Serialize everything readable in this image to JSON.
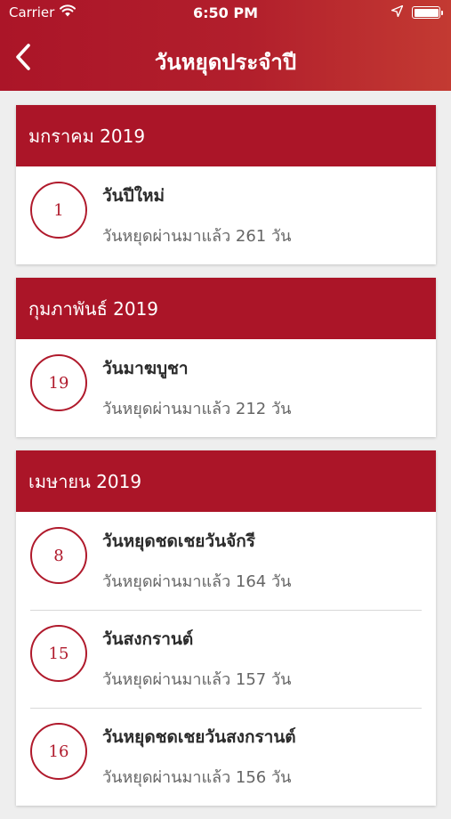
{
  "status_bar": {
    "carrier": "Carrier",
    "time": "6:50 PM",
    "wifi_icon": "wifi-icon",
    "location_icon": "location-arrow-icon",
    "battery_icon": "battery-icon"
  },
  "nav": {
    "back_icon": "chevron-left-icon",
    "title": "วันหยุดประจำปี"
  },
  "colors": {
    "primary": "#ab1528",
    "accent": "#b01a2c",
    "background": "#eeeeee"
  },
  "sections": [
    {
      "header": "มกราคม 2019",
      "items": [
        {
          "day": "1",
          "name": "วันปีใหม่",
          "passed": "วันหยุดผ่านมาแล้ว 261 วัน"
        }
      ]
    },
    {
      "header": "กุมภาพันธ์ 2019",
      "items": [
        {
          "day": "19",
          "name": "วันมาฆบูชา",
          "passed": "วันหยุดผ่านมาแล้ว 212 วัน"
        }
      ]
    },
    {
      "header": "เมษายน 2019",
      "items": [
        {
          "day": "8",
          "name": "วันหยุดชดเชยวันจักรี",
          "passed": "วันหยุดผ่านมาแล้ว 164 วัน"
        },
        {
          "day": "15",
          "name": "วันสงกรานต์",
          "passed": "วันหยุดผ่านมาแล้ว 157 วัน"
        },
        {
          "day": "16",
          "name": "วันหยุดชดเชยวันสงกรานต์",
          "passed": "วันหยุดผ่านมาแล้ว 156 วัน"
        }
      ]
    }
  ]
}
